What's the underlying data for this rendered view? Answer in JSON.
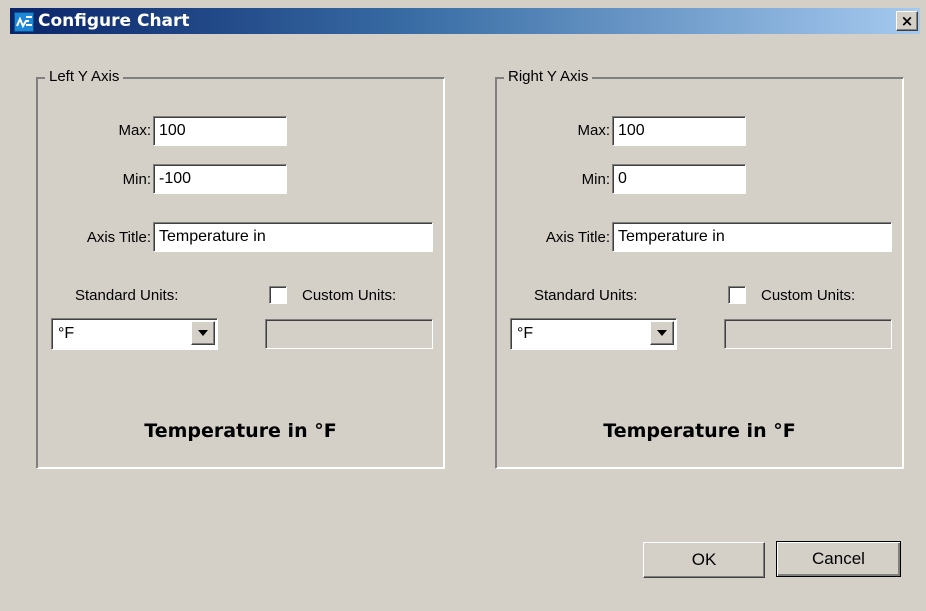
{
  "window": {
    "title": "Configure Chart",
    "close_label": "×",
    "app_icon": "chart-app-icon"
  },
  "left_axis": {
    "legend": "Left Y Axis",
    "max_label": "Max:",
    "max_value": "100",
    "min_label": "Min:",
    "min_value": "-100",
    "axis_title_label": "Axis Title:",
    "axis_title_value": "Temperature in",
    "standard_units_label": "Standard Units:",
    "standard_units_value": "°F",
    "custom_units_label": "Custom Units:",
    "custom_units_checked": false,
    "custom_units_value": "",
    "preview": "Temperature in °F"
  },
  "right_axis": {
    "legend": "Right Y Axis",
    "max_label": "Max:",
    "max_value": "100",
    "min_label": "Min:",
    "min_value": "0",
    "axis_title_label": "Axis Title:",
    "axis_title_value": "Temperature in",
    "standard_units_label": "Standard Units:",
    "standard_units_value": "°F",
    "custom_units_label": "Custom Units:",
    "custom_units_checked": false,
    "custom_units_value": "",
    "preview": "Temperature in °F"
  },
  "buttons": {
    "ok": "OK",
    "cancel": "Cancel"
  }
}
